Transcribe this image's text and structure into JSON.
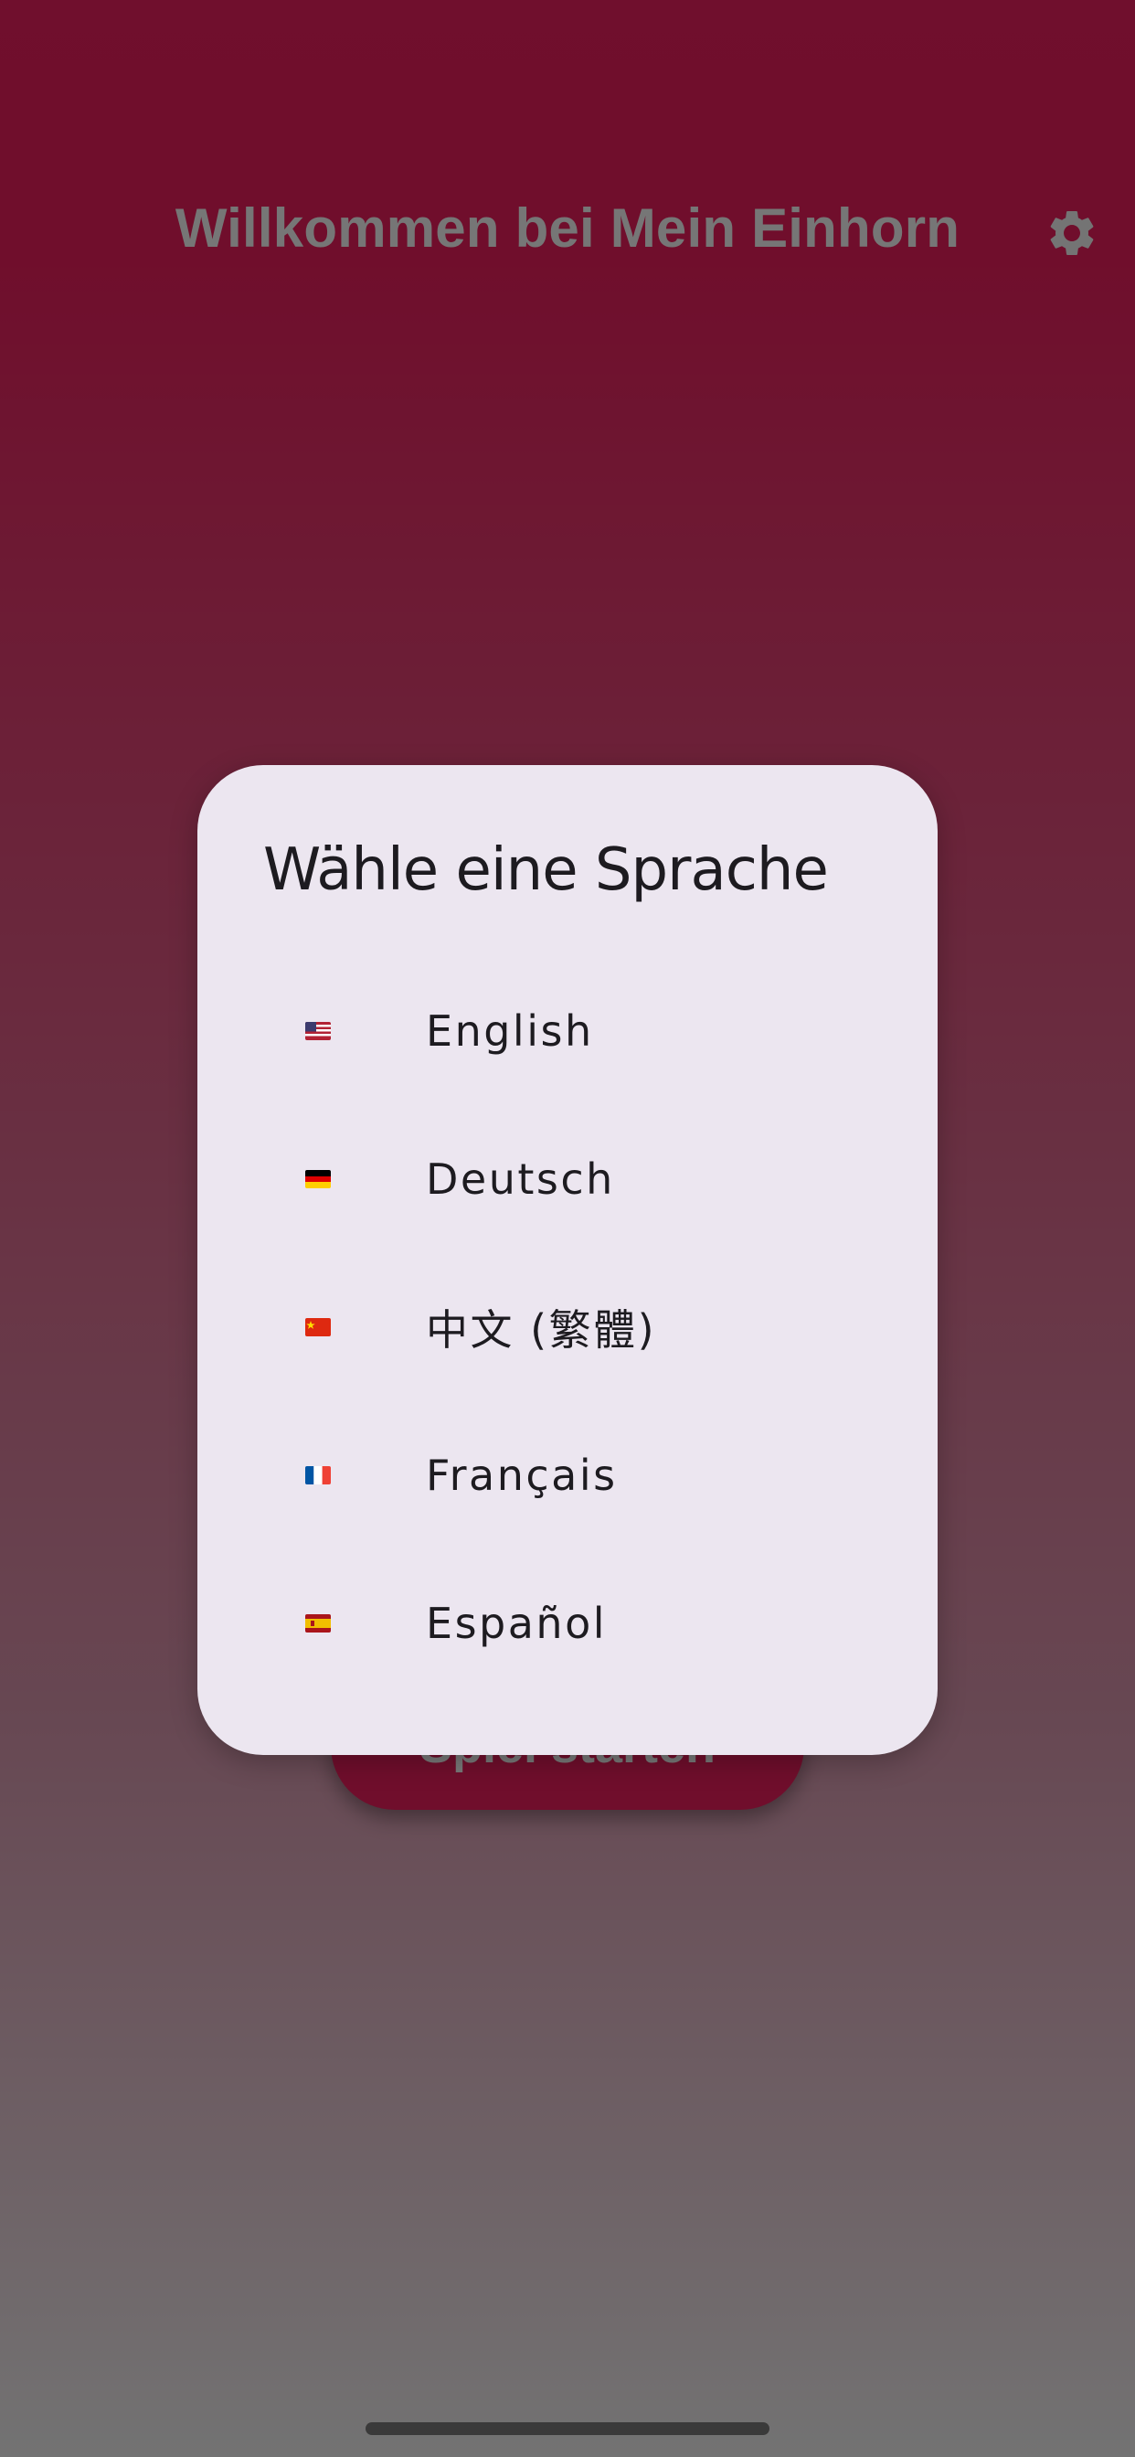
{
  "app": {
    "title": "Willkommen bei Mein Einhorn",
    "start_button_label": "Spiel starten",
    "settings_icon": "gear-icon"
  },
  "dialog": {
    "title": "Wähle eine Sprache",
    "languages": [
      {
        "label": "English",
        "flag": "flag-us-icon"
      },
      {
        "label": "Deutsch",
        "flag": "flag-de-icon"
      },
      {
        "label": "中文 (繁體)",
        "flag": "flag-cn-icon"
      },
      {
        "label": "Français",
        "flag": "flag-fr-icon"
      },
      {
        "label": "Español",
        "flag": "flag-es-icon"
      }
    ]
  },
  "colors": {
    "accent": "#e01c58",
    "dialog_bg": "#ece6f0",
    "text": "#1d1b20"
  }
}
